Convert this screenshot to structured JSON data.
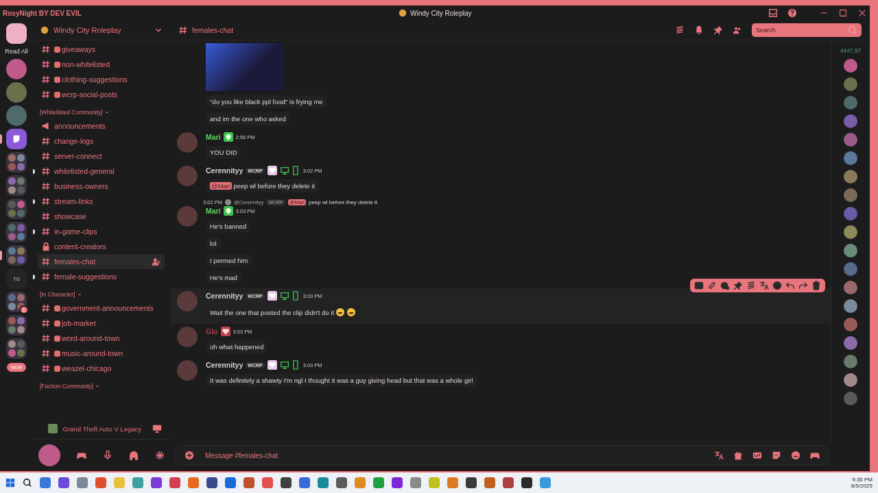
{
  "titlebar": {
    "theme": "RosyNight BY DEV EVIL",
    "title": "Windy City Roleplay"
  },
  "servers": {
    "read_all": "Read All",
    "new_badge": "NEW",
    "items": [
      {
        "kind": "avatar",
        "selected": false
      },
      {
        "kind": "avatar",
        "selected": false
      },
      {
        "kind": "avatar",
        "selected": false
      },
      {
        "kind": "stream",
        "selected": true
      },
      {
        "kind": "folder",
        "selected": false
      },
      {
        "kind": "folder",
        "selected": false
      },
      {
        "kind": "folder",
        "selected": false
      },
      {
        "kind": "folder",
        "selected": false
      },
      {
        "kind": "folder",
        "selected": true
      },
      {
        "kind": "text",
        "label": "TG",
        "selected": false
      },
      {
        "kind": "folder",
        "badge": "1",
        "selected": false
      },
      {
        "kind": "folder",
        "selected": false
      },
      {
        "kind": "folder",
        "selected": false
      }
    ]
  },
  "sidebar": {
    "server_name": "Windy City Roleplay",
    "sections": [
      {
        "channels": [
          {
            "name": "giveaways",
            "kind": "text",
            "emoji": true,
            "unread": false,
            "selected": false
          },
          {
            "name": "non-whitelisted",
            "kind": "text",
            "emoji": true,
            "unread": false,
            "selected": false
          },
          {
            "name": "clothing-suggestions",
            "kind": "text",
            "emoji": true,
            "unread": false,
            "selected": false
          },
          {
            "name": "wcrp-social-posts",
            "kind": "text",
            "emoji": true,
            "unread": false,
            "selected": false
          }
        ]
      },
      {
        "title": "[Whitelisted Community]",
        "channels": [
          {
            "name": "announcements",
            "kind": "announcement",
            "emoji": false,
            "unread": false,
            "selected": false
          },
          {
            "name": "change-logs",
            "kind": "text",
            "emoji": false,
            "unread": false,
            "selected": false
          },
          {
            "name": "server-connect",
            "kind": "text",
            "emoji": false,
            "unread": false,
            "selected": false
          },
          {
            "name": "whitelisted-general",
            "kind": "text",
            "emoji": false,
            "unread": true,
            "selected": false
          },
          {
            "name": "business-owners",
            "kind": "text",
            "emoji": false,
            "unread": false,
            "selected": false
          },
          {
            "name": "stream-links",
            "kind": "text",
            "emoji": false,
            "unread": true,
            "selected": false
          },
          {
            "name": "showcase",
            "kind": "text",
            "emoji": false,
            "unread": false,
            "selected": false
          },
          {
            "name": "in-game-clips",
            "kind": "text",
            "emoji": false,
            "unread": true,
            "selected": false
          },
          {
            "name": "content-creators",
            "kind": "locked",
            "emoji": false,
            "unread": false,
            "selected": false
          },
          {
            "name": "females-chat",
            "kind": "text",
            "emoji": false,
            "unread": false,
            "selected": true
          },
          {
            "name": "female-suggestions",
            "kind": "text",
            "emoji": false,
            "unread": true,
            "selected": false
          }
        ]
      },
      {
        "title": "[In Character]",
        "channels": [
          {
            "name": "government-announcements",
            "kind": "text",
            "emoji": true,
            "unread": false,
            "selected": false
          },
          {
            "name": "job-market",
            "kind": "text",
            "emoji": true,
            "unread": false,
            "selected": false
          },
          {
            "name": "word-around-town",
            "kind": "text",
            "emoji": true,
            "unread": false,
            "selected": false
          },
          {
            "name": "music-around-town",
            "kind": "text",
            "emoji": true,
            "unread": false,
            "selected": false
          },
          {
            "name": "weazel-chicago",
            "kind": "text",
            "emoji": true,
            "unread": false,
            "selected": false
          }
        ]
      },
      {
        "title": "[Faction Community]"
      }
    ],
    "activity": "Grand Theft Auto V Legacy"
  },
  "chat": {
    "channel": "females-chat",
    "search": {
      "placeholder": "Search"
    },
    "jump_count": "4447,97",
    "messages": [
      {
        "kind": "continuation",
        "image": true,
        "hovered": false,
        "lines": [
          {
            "text": "\"do you like black ppl food\" is frying me"
          },
          {
            "text": "and im the one who asked"
          }
        ]
      },
      {
        "kind": "message",
        "author": "Mari",
        "color": "#5fd35f",
        "role_badge": {
          "kind": "shield"
        },
        "time": "2:56 PM",
        "hovered": false,
        "lines": [
          {
            "text": "YOU DID"
          }
        ]
      },
      {
        "kind": "message",
        "author": "Cerennityy",
        "color": "#d8d0d0",
        "tag": "WCRP",
        "role_badge": {
          "kind": "heart-light"
        },
        "devices": true,
        "time": "3:02 PM",
        "hovered": false,
        "lines": [
          {
            "mention": "@Mari",
            "text": "peep wl before they delete it"
          }
        ]
      },
      {
        "kind": "message",
        "reply": {
          "time": "3:02 PM",
          "author": "@Cerennityy",
          "tag": "WCRP",
          "mention": "@Mari",
          "text": "peep wl before they delete it"
        },
        "author": "Mari",
        "color": "#5fd35f",
        "role_badge": {
          "kind": "shield"
        },
        "time": "3:03 PM",
        "hovered": false,
        "lines": [
          {
            "text": "He's banned"
          },
          {
            "text": "lol"
          },
          {
            "text": "I permed him"
          },
          {
            "text": "He's mad"
          }
        ]
      },
      {
        "kind": "message",
        "author": "Cerennityy",
        "color": "#d8d0d0",
        "tag": "WCRP",
        "role_badge": {
          "kind": "heart-light"
        },
        "devices": true,
        "time": "3:03 PM",
        "hovered": true,
        "lines": [
          {
            "text": "Wait the one that posted the clip didn't do it",
            "emojis": [
              {
                "kind": "laughing"
              },
              {
                "kind": "laughing"
              }
            ]
          }
        ]
      },
      {
        "kind": "message",
        "author": "Glo",
        "color": "#a0434c",
        "role_badge": {
          "kind": "heart"
        },
        "time": "3:03 PM",
        "hovered": false,
        "lines": [
          {
            "text": "oh what happened"
          }
        ]
      },
      {
        "kind": "message",
        "author": "Cerennityy",
        "color": "#d8d0d0",
        "tag": "WCRP",
        "role_badge": {
          "kind": "heart-light"
        },
        "devices": true,
        "time": "3:03 PM",
        "hovered": false,
        "lines": [
          {
            "text": "It was definitely a shawty I'm ngl I thought it was a guy giving head but that was a whole girl"
          }
        ]
      }
    ],
    "composer": {
      "placeholder": "Message #females-chat"
    }
  },
  "taskbar": {
    "time": "9:35 PM",
    "date": "8/5/2025"
  }
}
